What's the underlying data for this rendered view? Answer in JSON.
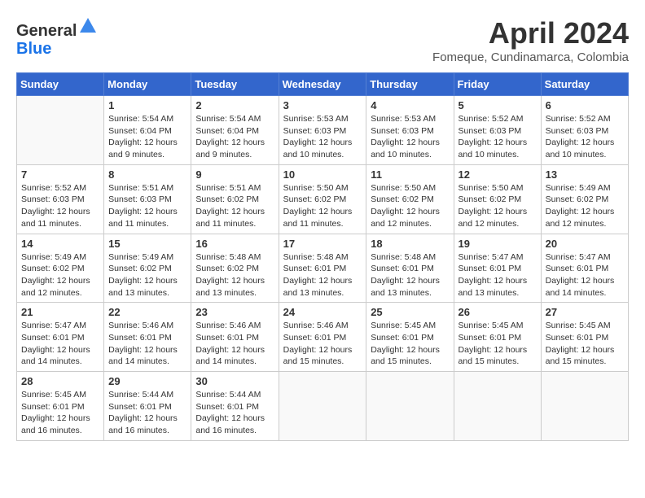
{
  "header": {
    "logo_line1": "General",
    "logo_line2": "Blue",
    "month": "April 2024",
    "location": "Fomeque, Cundinamarca, Colombia"
  },
  "weekdays": [
    "Sunday",
    "Monday",
    "Tuesday",
    "Wednesday",
    "Thursday",
    "Friday",
    "Saturday"
  ],
  "weeks": [
    [
      {
        "day": "",
        "sunrise": "",
        "sunset": "",
        "daylight": ""
      },
      {
        "day": "1",
        "sunrise": "Sunrise: 5:54 AM",
        "sunset": "Sunset: 6:04 PM",
        "daylight": "Daylight: 12 hours and 9 minutes."
      },
      {
        "day": "2",
        "sunrise": "Sunrise: 5:54 AM",
        "sunset": "Sunset: 6:04 PM",
        "daylight": "Daylight: 12 hours and 9 minutes."
      },
      {
        "day": "3",
        "sunrise": "Sunrise: 5:53 AM",
        "sunset": "Sunset: 6:03 PM",
        "daylight": "Daylight: 12 hours and 10 minutes."
      },
      {
        "day": "4",
        "sunrise": "Sunrise: 5:53 AM",
        "sunset": "Sunset: 6:03 PM",
        "daylight": "Daylight: 12 hours and 10 minutes."
      },
      {
        "day": "5",
        "sunrise": "Sunrise: 5:52 AM",
        "sunset": "Sunset: 6:03 PM",
        "daylight": "Daylight: 12 hours and 10 minutes."
      },
      {
        "day": "6",
        "sunrise": "Sunrise: 5:52 AM",
        "sunset": "Sunset: 6:03 PM",
        "daylight": "Daylight: 12 hours and 10 minutes."
      }
    ],
    [
      {
        "day": "7",
        "sunrise": "Sunrise: 5:52 AM",
        "sunset": "Sunset: 6:03 PM",
        "daylight": "Daylight: 12 hours and 11 minutes."
      },
      {
        "day": "8",
        "sunrise": "Sunrise: 5:51 AM",
        "sunset": "Sunset: 6:03 PM",
        "daylight": "Daylight: 12 hours and 11 minutes."
      },
      {
        "day": "9",
        "sunrise": "Sunrise: 5:51 AM",
        "sunset": "Sunset: 6:02 PM",
        "daylight": "Daylight: 12 hours and 11 minutes."
      },
      {
        "day": "10",
        "sunrise": "Sunrise: 5:50 AM",
        "sunset": "Sunset: 6:02 PM",
        "daylight": "Daylight: 12 hours and 11 minutes."
      },
      {
        "day": "11",
        "sunrise": "Sunrise: 5:50 AM",
        "sunset": "Sunset: 6:02 PM",
        "daylight": "Daylight: 12 hours and 12 minutes."
      },
      {
        "day": "12",
        "sunrise": "Sunrise: 5:50 AM",
        "sunset": "Sunset: 6:02 PM",
        "daylight": "Daylight: 12 hours and 12 minutes."
      },
      {
        "day": "13",
        "sunrise": "Sunrise: 5:49 AM",
        "sunset": "Sunset: 6:02 PM",
        "daylight": "Daylight: 12 hours and 12 minutes."
      }
    ],
    [
      {
        "day": "14",
        "sunrise": "Sunrise: 5:49 AM",
        "sunset": "Sunset: 6:02 PM",
        "daylight": "Daylight: 12 hours and 12 minutes."
      },
      {
        "day": "15",
        "sunrise": "Sunrise: 5:49 AM",
        "sunset": "Sunset: 6:02 PM",
        "daylight": "Daylight: 12 hours and 13 minutes."
      },
      {
        "day": "16",
        "sunrise": "Sunrise: 5:48 AM",
        "sunset": "Sunset: 6:02 PM",
        "daylight": "Daylight: 12 hours and 13 minutes."
      },
      {
        "day": "17",
        "sunrise": "Sunrise: 5:48 AM",
        "sunset": "Sunset: 6:01 PM",
        "daylight": "Daylight: 12 hours and 13 minutes."
      },
      {
        "day": "18",
        "sunrise": "Sunrise: 5:48 AM",
        "sunset": "Sunset: 6:01 PM",
        "daylight": "Daylight: 12 hours and 13 minutes."
      },
      {
        "day": "19",
        "sunrise": "Sunrise: 5:47 AM",
        "sunset": "Sunset: 6:01 PM",
        "daylight": "Daylight: 12 hours and 13 minutes."
      },
      {
        "day": "20",
        "sunrise": "Sunrise: 5:47 AM",
        "sunset": "Sunset: 6:01 PM",
        "daylight": "Daylight: 12 hours and 14 minutes."
      }
    ],
    [
      {
        "day": "21",
        "sunrise": "Sunrise: 5:47 AM",
        "sunset": "Sunset: 6:01 PM",
        "daylight": "Daylight: 12 hours and 14 minutes."
      },
      {
        "day": "22",
        "sunrise": "Sunrise: 5:46 AM",
        "sunset": "Sunset: 6:01 PM",
        "daylight": "Daylight: 12 hours and 14 minutes."
      },
      {
        "day": "23",
        "sunrise": "Sunrise: 5:46 AM",
        "sunset": "Sunset: 6:01 PM",
        "daylight": "Daylight: 12 hours and 14 minutes."
      },
      {
        "day": "24",
        "sunrise": "Sunrise: 5:46 AM",
        "sunset": "Sunset: 6:01 PM",
        "daylight": "Daylight: 12 hours and 15 minutes."
      },
      {
        "day": "25",
        "sunrise": "Sunrise: 5:45 AM",
        "sunset": "Sunset: 6:01 PM",
        "daylight": "Daylight: 12 hours and 15 minutes."
      },
      {
        "day": "26",
        "sunrise": "Sunrise: 5:45 AM",
        "sunset": "Sunset: 6:01 PM",
        "daylight": "Daylight: 12 hours and 15 minutes."
      },
      {
        "day": "27",
        "sunrise": "Sunrise: 5:45 AM",
        "sunset": "Sunset: 6:01 PM",
        "daylight": "Daylight: 12 hours and 15 minutes."
      }
    ],
    [
      {
        "day": "28",
        "sunrise": "Sunrise: 5:45 AM",
        "sunset": "Sunset: 6:01 PM",
        "daylight": "Daylight: 12 hours and 16 minutes."
      },
      {
        "day": "29",
        "sunrise": "Sunrise: 5:44 AM",
        "sunset": "Sunset: 6:01 PM",
        "daylight": "Daylight: 12 hours and 16 minutes."
      },
      {
        "day": "30",
        "sunrise": "Sunrise: 5:44 AM",
        "sunset": "Sunset: 6:01 PM",
        "daylight": "Daylight: 12 hours and 16 minutes."
      },
      {
        "day": "",
        "sunrise": "",
        "sunset": "",
        "daylight": ""
      },
      {
        "day": "",
        "sunrise": "",
        "sunset": "",
        "daylight": ""
      },
      {
        "day": "",
        "sunrise": "",
        "sunset": "",
        "daylight": ""
      },
      {
        "day": "",
        "sunrise": "",
        "sunset": "",
        "daylight": ""
      }
    ]
  ]
}
